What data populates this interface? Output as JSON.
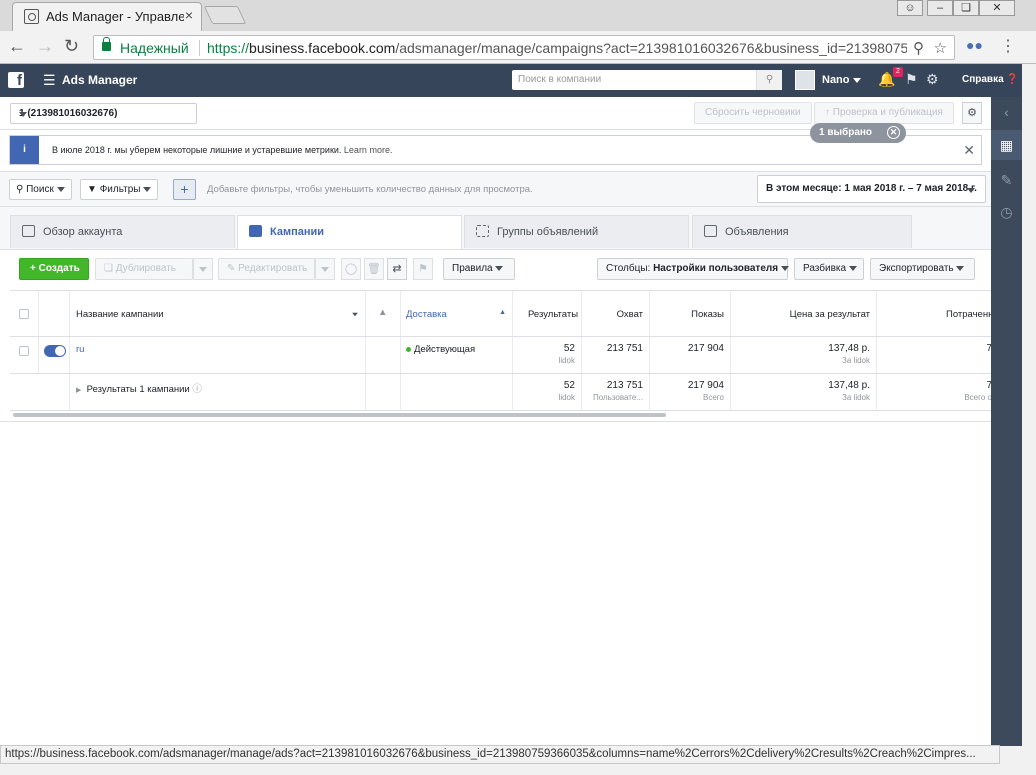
{
  "browser": {
    "tab_title": "Ads Manager - Управле",
    "tab_close": "×",
    "secure_label": "Надежный",
    "url_scheme": "https://",
    "url_host": "business.facebook.com",
    "url_path": "/adsmanager/manage/campaigns?act=213981016032676&business_id=21398075",
    "status_url": "https://business.facebook.com/adsmanager/manage/ads?act=213981016032676&business_id=213980759366035&columns=name%2Cerrors%2Cdelivery%2Cresults%2Creach%2Cimpres..."
  },
  "header": {
    "app_name": "Ads Manager",
    "search_placeholder": "Поиск в компании",
    "user_name": "Nano",
    "notifications_count": "2",
    "help_label": "Справка"
  },
  "account": {
    "selector": "1 (213981016032676)",
    "discard_label": "Сбросить черновики",
    "publish_label": "Проверка и публикация"
  },
  "notice": {
    "text": "В июле 2018 г. мы уберем некоторые лишние и устаревшие метрики.",
    "link": "Learn more."
  },
  "filters": {
    "search_label": "Поиск",
    "filters_label": "Фильтры",
    "hint": "Добавьте фильтры, чтобы уменьшить количество данных для просмотра.",
    "date_range": "В этом месяце: 1 мая 2018 г. – 7 мая 2018 г."
  },
  "tabs": [
    {
      "label": "Обзор аккаунта"
    },
    {
      "label": "Кампании"
    },
    {
      "label": "Группы объявлений"
    },
    {
      "label": "Объявления"
    }
  ],
  "selected_pill": "1 выбрано",
  "toolbar": {
    "create": "Создать",
    "duplicate": "Дублировать",
    "edit": "Редактировать",
    "rules": "Правила",
    "columns_prefix": "Столбцы:",
    "columns_value": "Настройки пользователя",
    "breakdown": "Разбивка",
    "export": "Экспортировать"
  },
  "table": {
    "headers": {
      "name": "Название кампании",
      "delivery": "Доставка",
      "results": "Результаты",
      "reach": "Охват",
      "impressions": "Показы",
      "cost": "Цена за результат",
      "spent": "Потраченн"
    },
    "rows": [
      {
        "name": "ru",
        "delivery": "Действующая",
        "results": "52",
        "results_sub": "lidok",
        "reach": "213 751",
        "impressions": "217 904",
        "cost": "137,48 р.",
        "cost_sub": "За lidok",
        "spent": "7"
      }
    ],
    "summary": {
      "name": "Результаты 1 кампании",
      "results": "52",
      "results_sub": "lidok",
      "reach": "213 751",
      "reach_sub": "Пользовате...",
      "impressions": "217 904",
      "impressions_sub": "Всего",
      "cost": "137,48 р.",
      "cost_sub": "За lidok",
      "spent": "7",
      "spent_sub": "Всего о"
    }
  },
  "colors": {
    "header_bg": "#364559",
    "brand_blue": "#4267b2",
    "create_green": "#42b72a",
    "secure_green": "#0b8043"
  }
}
